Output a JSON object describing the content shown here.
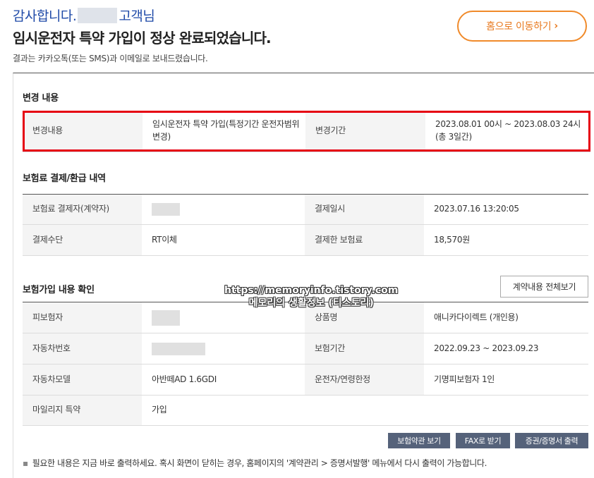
{
  "header": {
    "thanks_prefix": "감사합니다.",
    "thanks_suffix": "고객님",
    "title": "임시운전자 특약 가입이 정상 완료되었습니다.",
    "subtitle": "결과는 카카오톡(또는 SMS)과 이메일로 보내드렸습니다."
  },
  "home_button": {
    "label": "홈으로 이동하기",
    "icon": "chevron-right-icon"
  },
  "change": {
    "section_title": "변경 내용",
    "row": {
      "label1": "변경내용",
      "value1": "임시운전자 특약 가입(특정기간 운전자범위 변경)",
      "label2": "변경기간",
      "value2": "2023.08.01 00시 ~ 2023.08.03 24시 (총 3일간)"
    }
  },
  "payment": {
    "section_title": "보험료 결제/환급 내역",
    "rows": [
      {
        "label1": "보험료 결제자(계약자)",
        "value1": "",
        "label2": "결제일시",
        "value2": "2023.07.16 13:20:05"
      },
      {
        "label1": "결제수단",
        "value1": "RT이체",
        "label2": "결제한 보험료",
        "value2": "18,570원"
      }
    ]
  },
  "contract": {
    "section_title": "보험가입 내용 확인",
    "view_all_label": "계약내용 전체보기",
    "rows": [
      {
        "label1": "피보험자",
        "value1": "",
        "label2": "상품명",
        "value2": "애니카다이렉트 (개인용)"
      },
      {
        "label1": "자동차번호",
        "value1": "",
        "label2": "보험기간",
        "value2": "2022.09.23 ~ 2023.09.23"
      },
      {
        "label1": "자동차모델",
        "value1": "아반떼AD 1.6GDI",
        "label2": "운전자/연령한정",
        "value2": "기명피보험자 1인"
      },
      {
        "label1": "마일리지 특약",
        "value1": "가입",
        "label2": "",
        "value2": ""
      }
    ]
  },
  "actions": {
    "terms": "보험약관 보기",
    "fax": "FAX로 받기",
    "certificate": "증권/증명서 출력"
  },
  "note": "필요한 내용은 지금 바로 출력하세요. 혹시 화면이 닫히는 경우, 홈페이지의 '계약관리 > 증명서발행' 메뉴에서 다시 출력이 가능합니다.",
  "watermark": {
    "line1": "https://memoryinfo.tistory.com",
    "line2": "메모리의 생활정보 (티스토리)"
  },
  "colors": {
    "accent_blue": "#1f4aa8",
    "home_orange": "#f08a2a",
    "highlight_red": "#e60012",
    "button_slate": "#55627a"
  }
}
